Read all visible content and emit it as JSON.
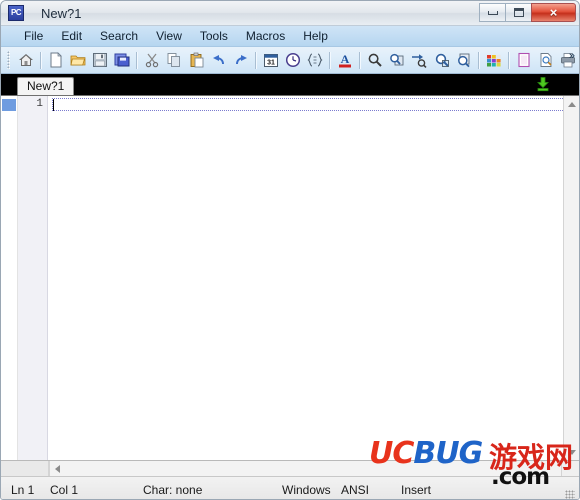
{
  "window": {
    "title": "New?1",
    "app_icon_label": "PC",
    "controls": [
      {
        "name": "minimize",
        "glyph": "minimize-icon"
      },
      {
        "name": "maximize",
        "glyph": "maximize-icon"
      },
      {
        "name": "close",
        "glyph": "×"
      }
    ]
  },
  "menubar": {
    "items": [
      {
        "label": "File"
      },
      {
        "label": "Edit"
      },
      {
        "label": "Search"
      },
      {
        "label": "View"
      },
      {
        "label": "Tools"
      },
      {
        "label": "Macros"
      },
      {
        "label": "Help"
      }
    ]
  },
  "toolbar": {
    "overflow_label": "»",
    "groups": [
      {
        "buttons": [
          {
            "icon": "home-icon"
          }
        ]
      },
      {
        "buttons": [
          {
            "icon": "new-file-icon"
          },
          {
            "icon": "open-folder-icon"
          },
          {
            "icon": "save-icon"
          },
          {
            "icon": "save-all-icon"
          }
        ]
      },
      {
        "buttons": [
          {
            "icon": "cut-icon"
          },
          {
            "icon": "copy-icon"
          },
          {
            "icon": "paste-icon"
          },
          {
            "icon": "undo-icon"
          },
          {
            "icon": "redo-icon"
          }
        ]
      },
      {
        "buttons": [
          {
            "icon": "calendar-icon",
            "label": "31"
          },
          {
            "icon": "clock-icon"
          },
          {
            "icon": "format-code-icon"
          }
        ]
      },
      {
        "buttons": [
          {
            "icon": "font-color-icon",
            "label": "A"
          }
        ]
      },
      {
        "buttons": [
          {
            "icon": "search-icon"
          },
          {
            "icon": "find-in-files-icon"
          },
          {
            "icon": "goto-line-icon"
          },
          {
            "icon": "find-next-icon"
          },
          {
            "icon": "find-previous-icon"
          }
        ]
      },
      {
        "buttons": [
          {
            "icon": "color-palette-icon"
          }
        ]
      },
      {
        "buttons": [
          {
            "icon": "page-setup-icon"
          },
          {
            "icon": "print-preview-icon"
          },
          {
            "icon": "print-icon"
          }
        ]
      }
    ]
  },
  "tabstrip": {
    "tabs": [
      {
        "label": "New?1",
        "active": true
      }
    ],
    "action_icon": "save-download-icon"
  },
  "editor": {
    "lines": [
      {
        "number": "1",
        "text": "",
        "bookmarked": true
      }
    ]
  },
  "statusbar": {
    "line": "Ln 1",
    "column": "Col 1",
    "char": "Char: none",
    "line_ending": "Windows",
    "encoding": "ANSI",
    "insert_mode": "Insert"
  },
  "watermark": {
    "uc": "UC",
    "bug": "BUG",
    "cn": "游戏网",
    "com": ".com"
  },
  "colors": {
    "menubar": "#b6d6f0",
    "toolbar": "#dcecf9",
    "tabstrip": "#000000",
    "editor_bg": "#ffffff",
    "bookmark": "#6f9ce0",
    "close_button": "#e2503a",
    "watermark_red": "#e8331c",
    "watermark_blue": "#1f64c8"
  }
}
